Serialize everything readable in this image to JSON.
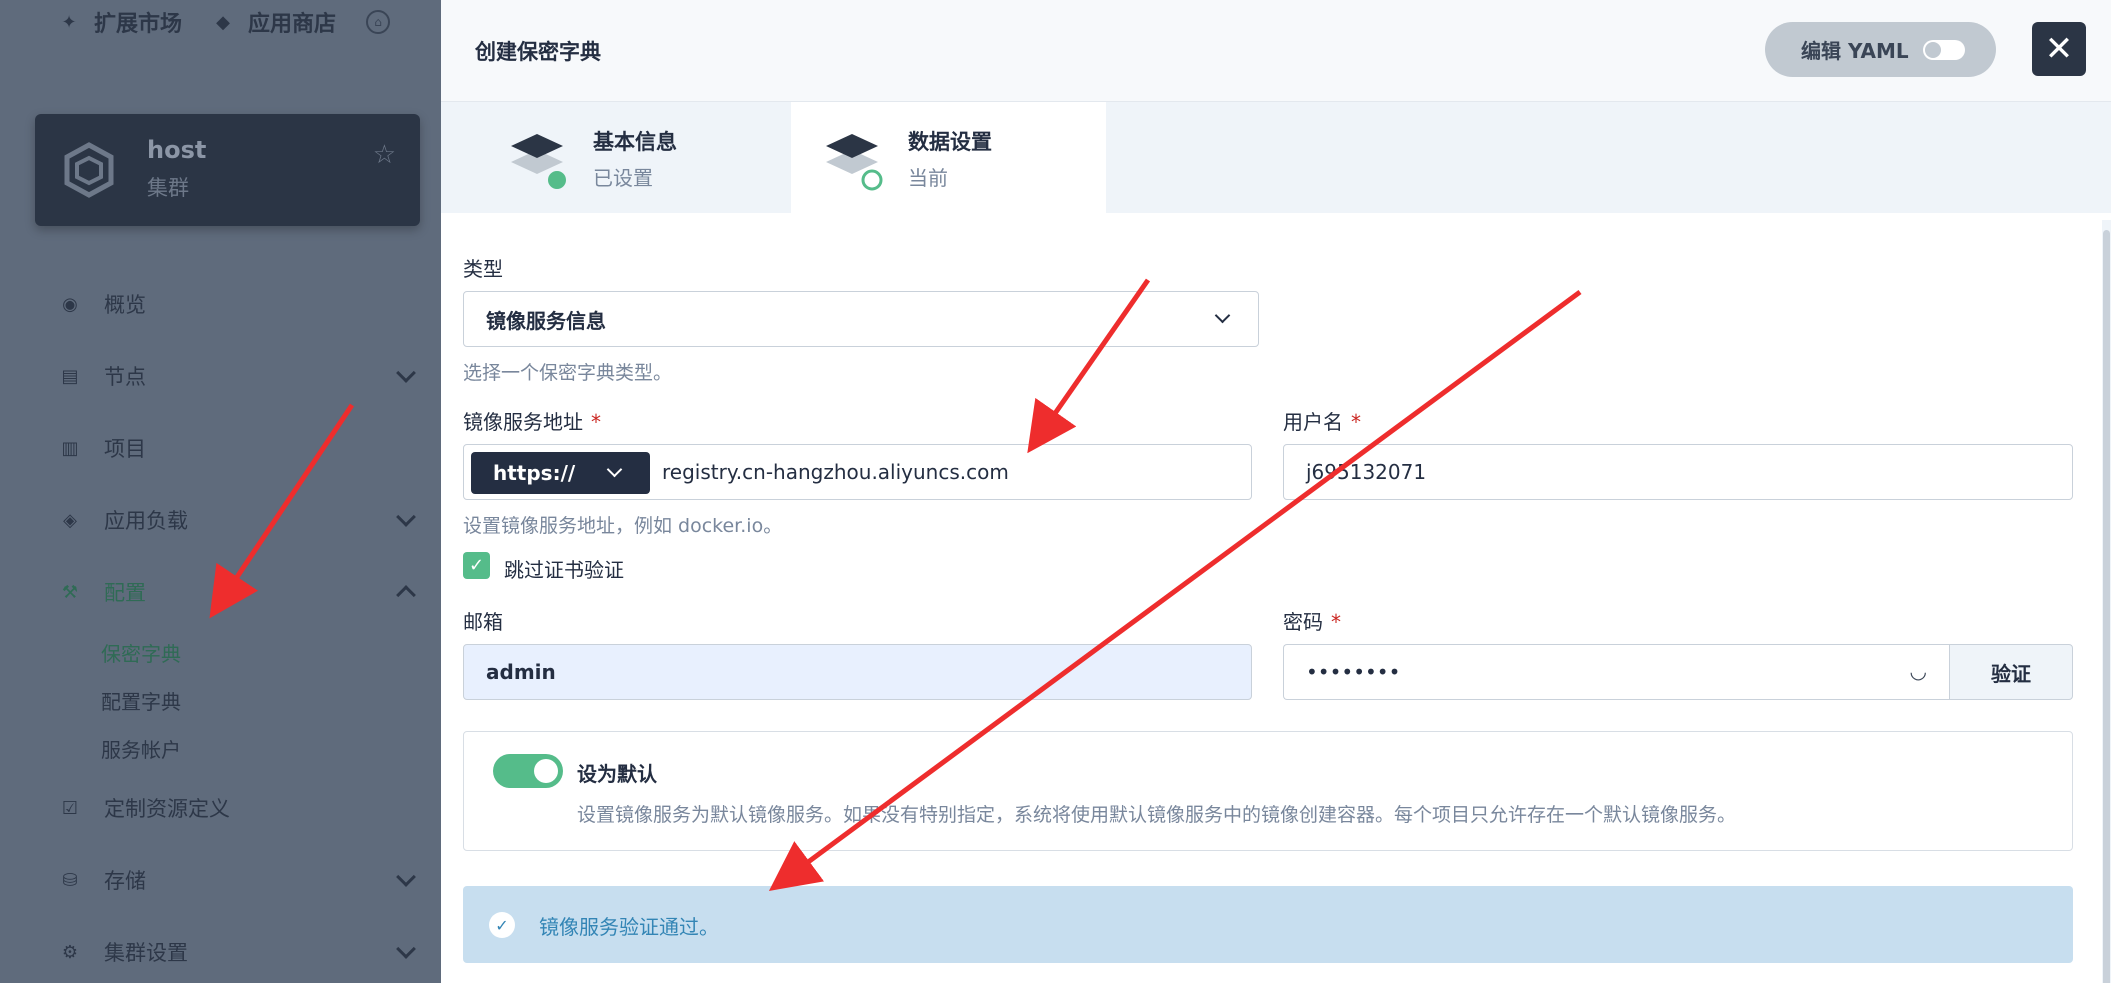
{
  "colors": {
    "accent_green": "#55bc8a",
    "dark": "#242e42",
    "info_blue": "#3385b5",
    "arrow_red": "#ee2d2d"
  },
  "sidebar": {
    "top_links": [
      {
        "label": "扩展市场",
        "icon": "puzzle-icon"
      },
      {
        "label": "应用商店",
        "icon": "layers-icon"
      }
    ],
    "cluster": {
      "name": "host",
      "type": "集群"
    },
    "nav": [
      {
        "label": "概览",
        "icon": "dashboard-icon"
      },
      {
        "label": "节点",
        "icon": "server-icon"
      },
      {
        "label": "项目",
        "icon": "project-icon"
      },
      {
        "label": "应用负载",
        "icon": "workload-icon"
      },
      {
        "label": "配置",
        "icon": "hammer-icon"
      },
      {
        "label": "定制资源定义",
        "icon": "crd-icon"
      },
      {
        "label": "存储",
        "icon": "database-icon"
      },
      {
        "label": "集群设置",
        "icon": "gear-icon"
      }
    ],
    "config_sub": [
      "保密字典",
      "配置字典",
      "服务帐户"
    ]
  },
  "drawer": {
    "title": "创建保密字典",
    "yaml_toggle_label": "编辑 YAML",
    "steps": [
      {
        "title": "基本信息",
        "status": "已设置"
      },
      {
        "title": "数据设置",
        "status": "当前"
      }
    ]
  },
  "form": {
    "type_label": "类型",
    "type_value": "镜像服务信息",
    "type_hint": "选择一个保密字典类型。",
    "registry_label": "镜像服务地址",
    "registry_protocol": "https://",
    "registry_value": "registry.cn-hangzhou.aliyuncs.com",
    "registry_hint": "设置镜像服务地址，例如 docker.io。",
    "username_label": "用户名",
    "username_value": "j695132071",
    "skip_tls_label": "跳过证书验证",
    "email_label": "邮箱",
    "email_value": "admin",
    "password_label": "密码",
    "password_value": "••••••••",
    "verify_label": "验证",
    "required_mark": "*",
    "default_title": "设为默认",
    "default_desc": "设置镜像服务为默认镜像服务。如果没有特别指定，系统将使用默认镜像服务中的镜像创建容器。每个项目只允许存在一个默认镜像服务。",
    "success_message": "镜像服务验证通过。"
  }
}
